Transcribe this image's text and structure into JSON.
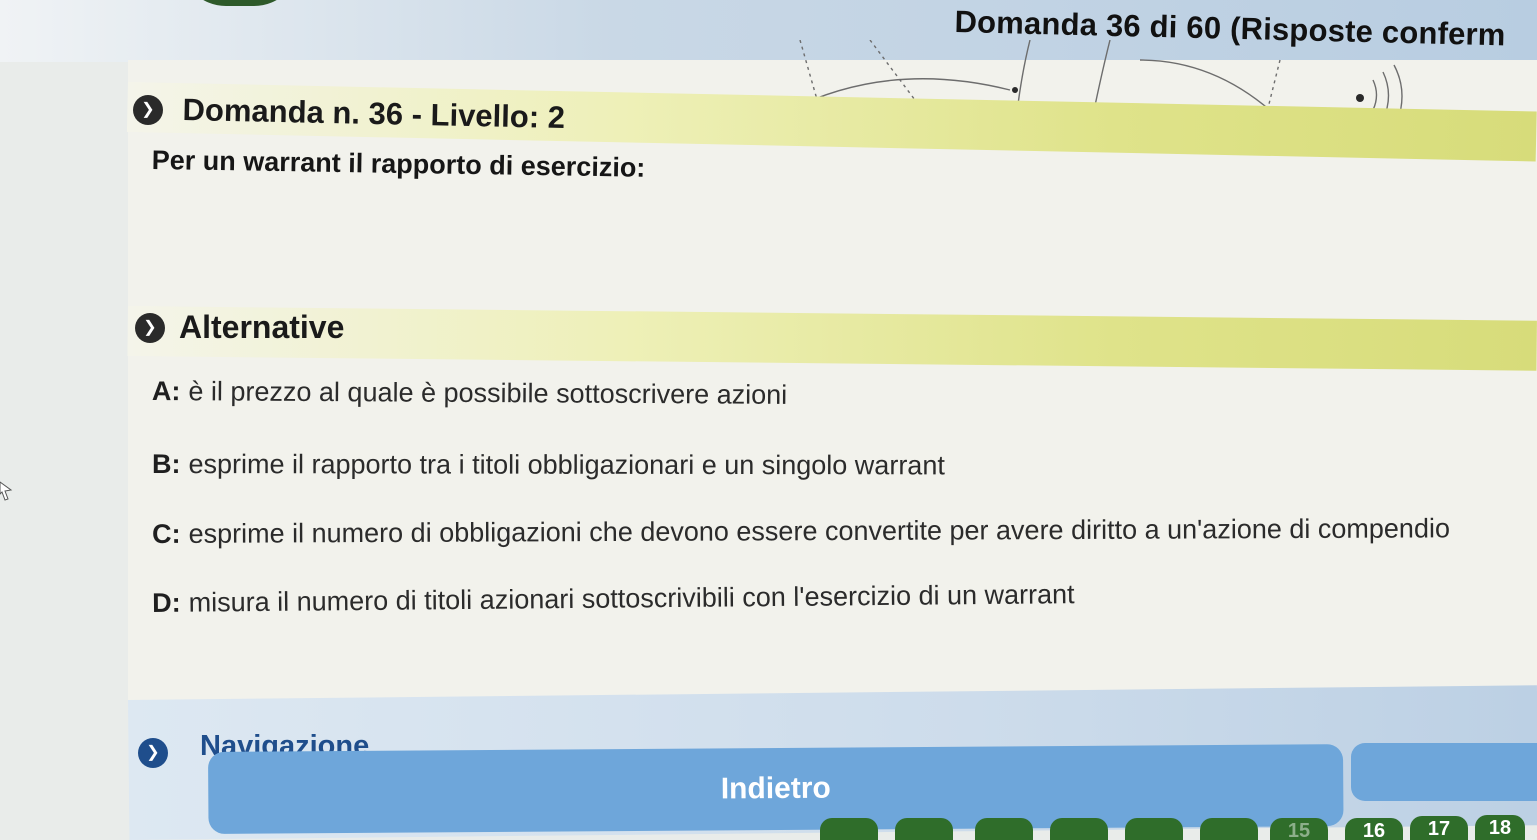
{
  "header": {
    "exam_progress": "Domanda 36 di 60 (Risposte conferm"
  },
  "question": {
    "heading": "Domanda n. 36 - Livello: 2",
    "text": "Per un warrant il rapporto di esercizio:"
  },
  "alternatives": {
    "heading": "Alternative",
    "options": [
      {
        "letter": "A:",
        "text": "è il prezzo al quale è possibile sottoscrivere azioni"
      },
      {
        "letter": "B:",
        "text": "esprime il rapporto tra i titoli obbligazionari e un singolo warrant"
      },
      {
        "letter": "C:",
        "text": "esprime il numero di obbligazioni che devono essere convertite per avere diritto a un'azione di compendio"
      },
      {
        "letter": "D:",
        "text": "misura il numero di titoli azionari sottoscrivibili con l'esercizio di un warrant"
      }
    ]
  },
  "navigation": {
    "heading": "Navigazione",
    "back_label": "Indietro",
    "pages": [
      "",
      "",
      "",
      "",
      "",
      "",
      "15",
      "16",
      "17",
      "18"
    ]
  },
  "colors": {
    "accent_blue": "#6ea6da",
    "page_green": "#2f6d2a",
    "section_yellow": "#dfe38a"
  }
}
